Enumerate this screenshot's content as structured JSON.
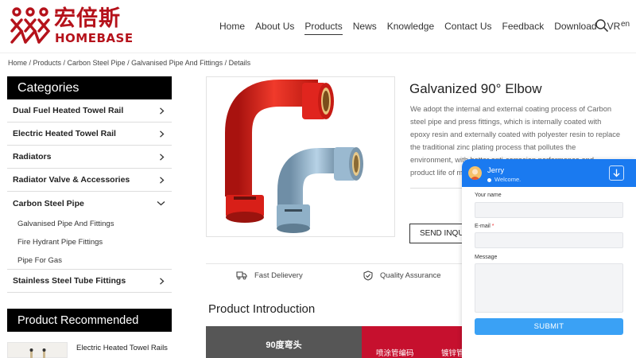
{
  "brand": {
    "cn_name": "宏倍斯",
    "en_name": "HOMEBASE",
    "color": "#b5121b"
  },
  "nav": {
    "items": [
      {
        "label": "Home",
        "active": false
      },
      {
        "label": "About Us",
        "active": false
      },
      {
        "label": "Products",
        "active": true
      },
      {
        "label": "News",
        "active": false
      },
      {
        "label": "Knowledge",
        "active": false
      },
      {
        "label": "Contact Us",
        "active": false
      },
      {
        "label": "Feedback",
        "active": false
      },
      {
        "label": "Download",
        "active": false
      },
      {
        "label": "VR",
        "active": false
      }
    ],
    "search_icon": "search-icon",
    "language": "en"
  },
  "breadcrumb": "Home / Products / Carbon Steel Pipe / Galvanised Pipe And Fittings / Details",
  "sidebar": {
    "title": "Categories",
    "items": [
      {
        "label": "Dual Fuel Heated Towel Rail",
        "expanded": false
      },
      {
        "label": "Electric Heated Towel Rail",
        "expanded": false
      },
      {
        "label": "Radiators",
        "expanded": false
      },
      {
        "label": "Radiator Valve & Accessories",
        "expanded": false
      },
      {
        "label": "Carbon Steel Pipe",
        "expanded": true
      },
      {
        "label": "Stainless Steel Tube Fittings",
        "expanded": false
      }
    ],
    "subitems": [
      "Galvanised Pipe And Fittings",
      "Fire Hydrant Pipe Fittings",
      "Pipe For Gas"
    ],
    "recommended_title": "Product Recommended",
    "recommended_item": "Electric Heated Towel Rails"
  },
  "product": {
    "title": "Galvanized 90° Elbow",
    "description_lines": [
      "We adopt the internal and external coating process of Carbon",
      "steel pipe and press fittings, which is internally coated with",
      "epoxy resin and externally coated with polyester resin to replace",
      "the traditional zinc plating process that pollutes the",
      "environment, with better anti-corrosion performance and",
      "product life of m"
    ],
    "send_inquiry": "SEND INQUIRY",
    "features": [
      "Fast Delievery",
      "Quality Assurance"
    ],
    "intro_title": "Product Introduction",
    "table": {
      "header_left": "90度弯头",
      "header_sub_1": "喷涂管编码",
      "header_sub_2": "镀锌管"
    },
    "colors": {
      "red_fitting": "#e0251e",
      "galv_fitting": "#8fb4cf"
    }
  },
  "chat": {
    "agent_name": "Jerry",
    "status": "Welcome.",
    "fields": [
      {
        "label": "Your name",
        "required": false
      },
      {
        "label": "E-mail",
        "required": true
      },
      {
        "label": "Message",
        "required": false
      }
    ],
    "submit": "SUBMIT",
    "header_color": "#1a7af0",
    "button_color": "#3aa1f5"
  }
}
